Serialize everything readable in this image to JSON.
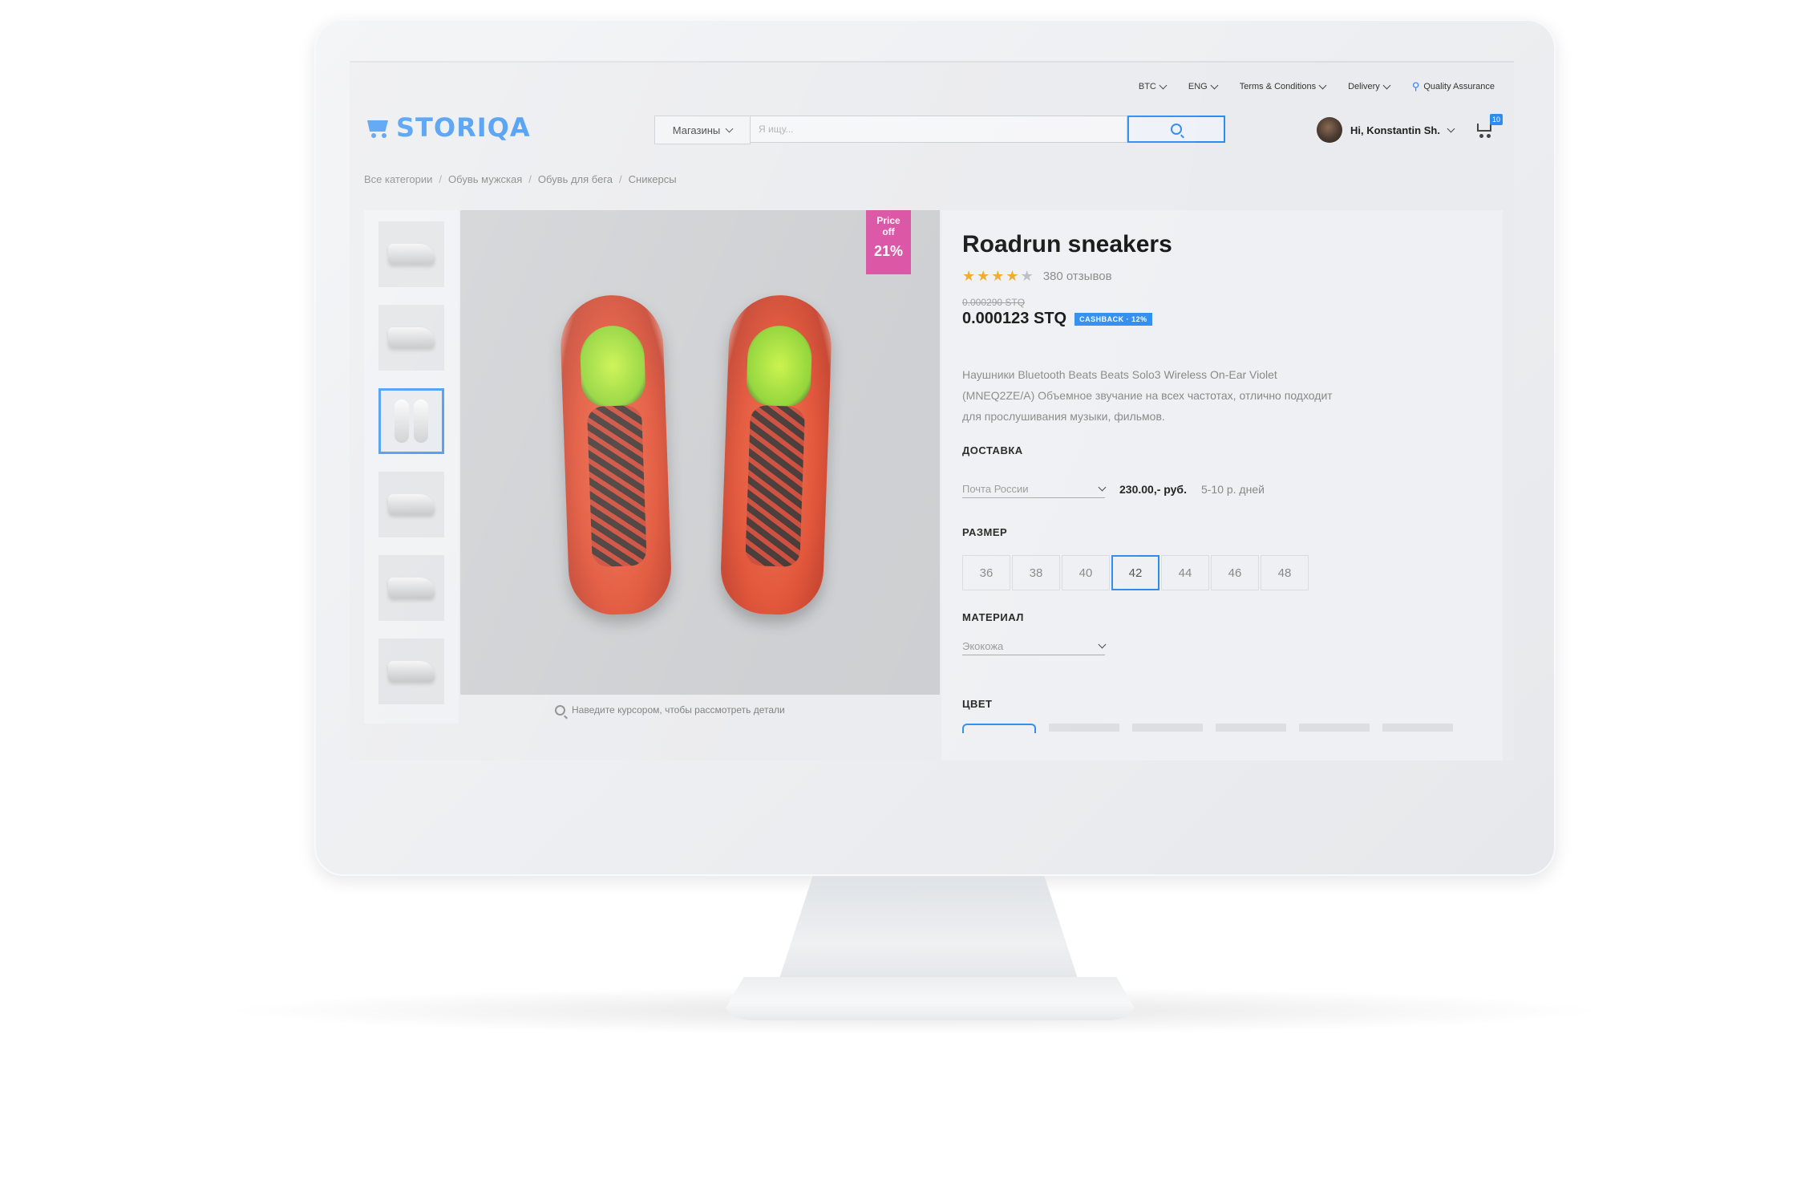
{
  "topbar": {
    "currency": "BTC",
    "language": "ENG",
    "terms": "Terms & Conditions",
    "delivery": "Delivery",
    "quality": "Quality Assurance"
  },
  "header": {
    "logo_text": "STORIQA",
    "shop_select": "Магазины",
    "search_placeholder": "Я ищу...",
    "user_name": "Hi, Konstantin Sh.",
    "cart_count": "10"
  },
  "breadcrumb": [
    "Все категории",
    "Обувь мужская",
    "Обувь для бега",
    "Сникерсы"
  ],
  "gallery": {
    "thumbnails": [
      {
        "icon": "shoe-side-icon",
        "active": false
      },
      {
        "icon": "shoe-high-icon",
        "active": false
      },
      {
        "icon": "shoe-pair-icon",
        "active": true
      },
      {
        "icon": "shoe-high-icon",
        "active": false
      },
      {
        "icon": "shoe-high-icon",
        "active": false
      },
      {
        "icon": "shoe-high-icon",
        "active": false
      }
    ],
    "badge_line1": "Price",
    "badge_line2": "off",
    "badge_percent": "21%",
    "zoom_hint": "Наведите курсором, чтобы рассмотреть детали"
  },
  "product": {
    "title": "Roadrun sneakers",
    "rating": 4,
    "rating_max": 5,
    "reviews": "380 отзывов",
    "old_price": "0.000290 STQ",
    "price": "0.000123 STQ",
    "cashback": "CASHBACK · 12%",
    "description": "Наушники Bluetooth Beats Beats Solo3 Wireless On-Ear Violet (MNEQ2ZE/A) Объемное звучание на всех частотах, отлично подходит для прослушивания музыки, фильмов.",
    "delivery_label": "ДОСТАВКА",
    "delivery_method": "Почта России",
    "delivery_price": "230.00,- руб.",
    "delivery_days": "5-10 р. дней",
    "size_label": "РАЗМЕР",
    "sizes": [
      "36",
      "38",
      "40",
      "42",
      "44",
      "46",
      "48"
    ],
    "selected_size": "42",
    "material_label": "МАТЕРИАЛ",
    "material_value": "Экокожа",
    "color_label": "ЦВЕТ"
  },
  "colors": {
    "accent": "#2d8cf0",
    "badge": "#d94aa0",
    "star": "#f0a820"
  }
}
